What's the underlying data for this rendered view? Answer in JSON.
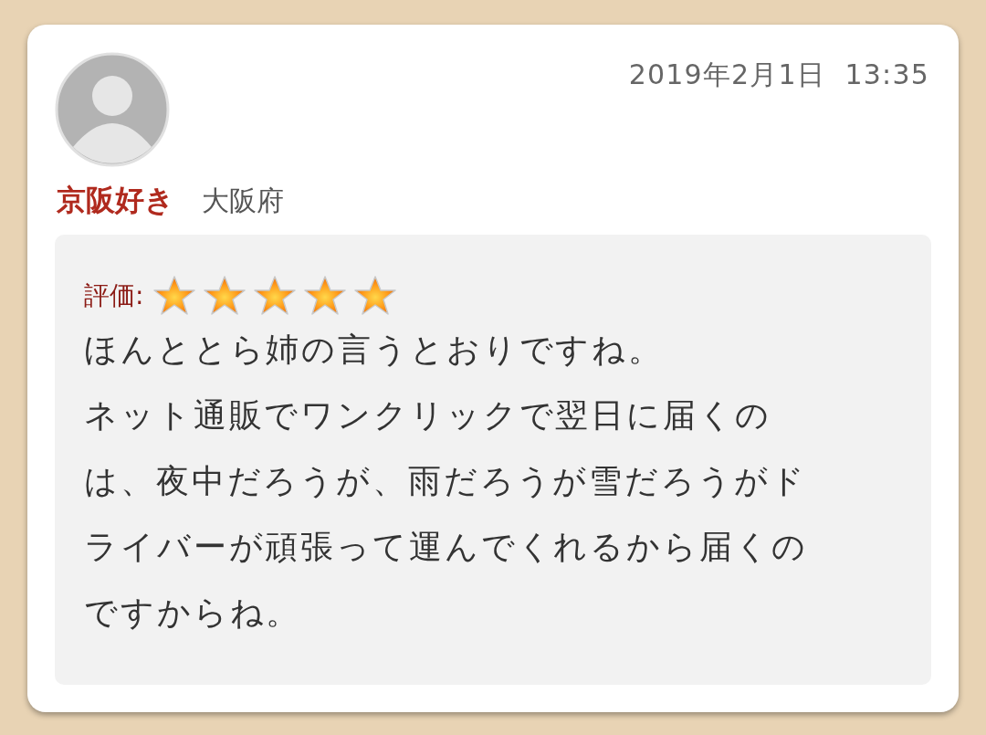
{
  "review": {
    "date": "2019年2月1日  13:35",
    "author": "京阪好き",
    "location": "大阪府",
    "rating_label": "評価:",
    "stars": 5,
    "lines": [
      "ほんととら姉の言うとおりですね。",
      "ネット通販でワンクリックで翌日に届くの",
      "は、夜中だろうが、雨だろうが雪だろうがド",
      "ライバーが頑張って運んでくれるから届くの",
      "ですからね。"
    ]
  }
}
